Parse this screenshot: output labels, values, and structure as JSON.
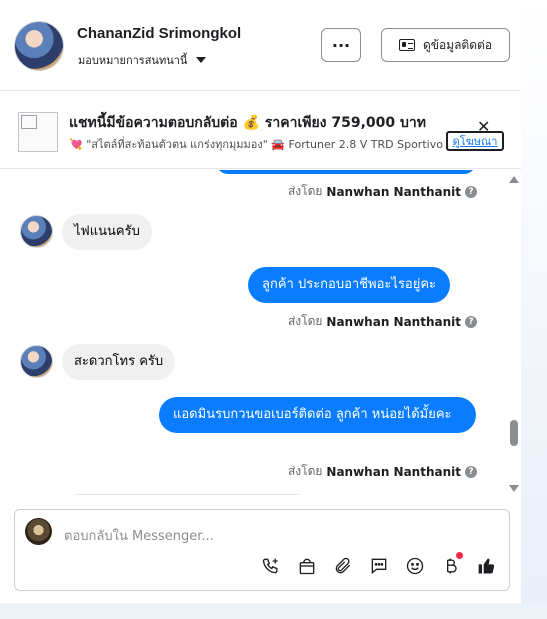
{
  "header": {
    "contact_name": "ChananZid Srimongkol",
    "assign_label": "มอบหมายการสนทนานี้",
    "more_label": "···",
    "contact_info_label": "ดูข้อมูลติดต่อ"
  },
  "ad": {
    "title": "แชทนี้มีข้อความตอบกลับต่อ 💰 ราคาเพียง 759,000 บาท",
    "subtitle": "💘 \"สไตล์ที่สะท้อนตัวตน แกร่งทุกมุมมอง\" 🚘 Fortuner 2.8 V TRD Sportivo",
    "link_label": "ดูโฆษณา",
    "close_label": "✕"
  },
  "messages": [
    {
      "direction": "in",
      "text": "ไฟแนนครับ"
    },
    {
      "direction": "out",
      "text": "ลูกค้า  ประกอบอาชีพอะไรอยู่คะ"
    },
    {
      "direction": "in",
      "text": "สะดวกโทร ครับ"
    },
    {
      "direction": "out",
      "text": "แอดมินรบกวนขอเบอร์ติดต่อ ลูกค้า  หน่อยได้มั้ยคะ"
    }
  ],
  "sent_by": {
    "prefix": "ส่งโดย",
    "name": "Nanwhan Nanthanit",
    "info": "?"
  },
  "composer": {
    "placeholder": "ตอบกลับใน Messenger..."
  },
  "toolbar_icons": [
    "phone-add-icon",
    "shopping-bag-icon",
    "paperclip-icon",
    "saved-replies-icon",
    "emoji-icon",
    "baht-icon",
    "thumbs-up-icon"
  ],
  "colors": {
    "outgoing_bubble": "#0a7cff",
    "incoming_bubble": "#f0f0f0",
    "link": "#1877f2",
    "notification_dot": "#f02849"
  }
}
